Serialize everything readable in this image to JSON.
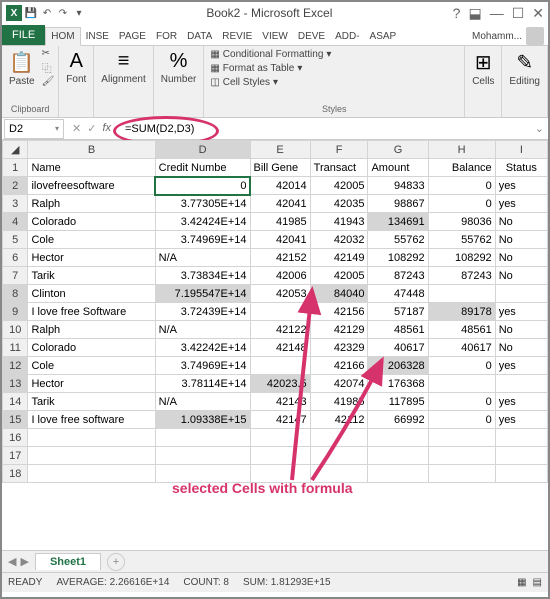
{
  "window": {
    "title": "Book2 - Microsoft Excel"
  },
  "tabs": {
    "file": "FILE",
    "t0": "HOM",
    "t1": "INSE",
    "t2": "PAGE",
    "t3": "FOR",
    "t4": "DATA",
    "t5": "REVIE",
    "t6": "VIEW",
    "t7": "DEVE",
    "t8": "ADD-",
    "t9": "ASAP",
    "signin": "Mohamm..."
  },
  "ribbon": {
    "clipboard": {
      "paste": "Paste",
      "label": "Clipboard"
    },
    "font": {
      "btn": "Font"
    },
    "alignment": {
      "btn": "Alignment"
    },
    "number": {
      "btn": "Number"
    },
    "styles": {
      "cond": "Conditional Formatting",
      "table": "Format as Table",
      "cell": "Cell Styles",
      "label": "Styles"
    },
    "cells": {
      "btn": "Cells"
    },
    "editing": {
      "btn": "Editing"
    }
  },
  "formulaBar": {
    "nameBox": "D2",
    "formula": "=SUM(D2,D3)"
  },
  "headers": {
    "B": "B",
    "D": "D",
    "E": "E",
    "F": "F",
    "G": "G",
    "H": "H",
    "I": "I"
  },
  "row1": {
    "B": "Name",
    "D": "Credit Numbe",
    "E": "Bill Gene",
    "F": "Transact",
    "G": "Amount",
    "H": "Balance",
    "I": "Status"
  },
  "rows": [
    {
      "n": "2",
      "B": "ilovefreesoftware",
      "D": "0",
      "E": "42014",
      "F": "42005",
      "G": "94833",
      "H": "0",
      "I": "yes",
      "selD": true,
      "active": true
    },
    {
      "n": "3",
      "B": "Ralph",
      "D": "3.77305E+14",
      "E": "42041",
      "F": "42035",
      "G": "98867",
      "H": "0",
      "I": "yes"
    },
    {
      "n": "4",
      "B": "Colorado",
      "D": "3.42424E+14",
      "E": "41985",
      "F": "41943",
      "G": "134691",
      "H": "98036",
      "I": "No",
      "selG": true
    },
    {
      "n": "5",
      "B": "Cole",
      "D": "3.74969E+14",
      "E": "42041",
      "F": "42032",
      "G": "55762",
      "H": "55762",
      "I": "No"
    },
    {
      "n": "6",
      "B": "Hector",
      "D": "N/A",
      "Dtxt": true,
      "E": "42152",
      "F": "42149",
      "G": "108292",
      "H": "108292",
      "I": "No"
    },
    {
      "n": "7",
      "B": "Tarik",
      "D": "3.73834E+14",
      "E": "42006",
      "F": "42005",
      "G": "87243",
      "H": "87243",
      "I": "No"
    },
    {
      "n": "8",
      "B": "Clinton",
      "D": "7.195547E+14",
      "E": "42053",
      "F": "84040",
      "G": "47448",
      "H": "",
      "I": "",
      "selD": true,
      "selF": true
    },
    {
      "n": "9",
      "B": "I love free Software",
      "D": "3.72439E+14",
      "E": "",
      "F": "42156",
      "G": "57187",
      "H": "89178",
      "I": "yes",
      "selH": true
    },
    {
      "n": "10",
      "B": "Ralph",
      "D": "N/A",
      "Dtxt": true,
      "E": "42122",
      "F": "42129",
      "G": "48561",
      "H": "48561",
      "I": "No"
    },
    {
      "n": "11",
      "B": "Colorado",
      "D": "3.42242E+14",
      "E": "42148",
      "F": "42329",
      "G": "40617",
      "H": "40617",
      "I": "No"
    },
    {
      "n": "12",
      "B": "Cole",
      "D": "3.74969E+14",
      "E": "",
      "F": "42166",
      "G": "206328",
      "H": "0",
      "I": "yes",
      "selG": true
    },
    {
      "n": "13",
      "B": "Hector",
      "D": "3.78114E+14",
      "E": "42023.5",
      "F": "42074",
      "G": "176368",
      "H": "",
      "I": "",
      "selE": true
    },
    {
      "n": "14",
      "B": "Tarik",
      "D": "N/A",
      "Dtxt": true,
      "E": "42143",
      "F": "41985",
      "G": "117895",
      "H": "0",
      "I": "yes"
    },
    {
      "n": "15",
      "B": "I love free software",
      "D": "1.09338E+15",
      "E": "42147",
      "F": "42112",
      "G": "66992",
      "H": "0",
      "I": "yes",
      "selD": true
    },
    {
      "n": "16",
      "B": "",
      "D": "",
      "E": "",
      "F": "",
      "G": "",
      "H": "",
      "I": ""
    },
    {
      "n": "17",
      "B": "",
      "D": "",
      "E": "",
      "F": "",
      "G": "",
      "H": "",
      "I": ""
    },
    {
      "n": "18",
      "B": "",
      "D": "",
      "E": "",
      "F": "",
      "G": "",
      "H": "",
      "I": ""
    }
  ],
  "annotation": "selected Cells with formula",
  "sheet": {
    "name": "Sheet1"
  },
  "status": {
    "ready": "READY",
    "avg": "AVERAGE: 2.26616E+14",
    "count": "COUNT: 8",
    "sum": "SUM: 1.81293E+15"
  }
}
